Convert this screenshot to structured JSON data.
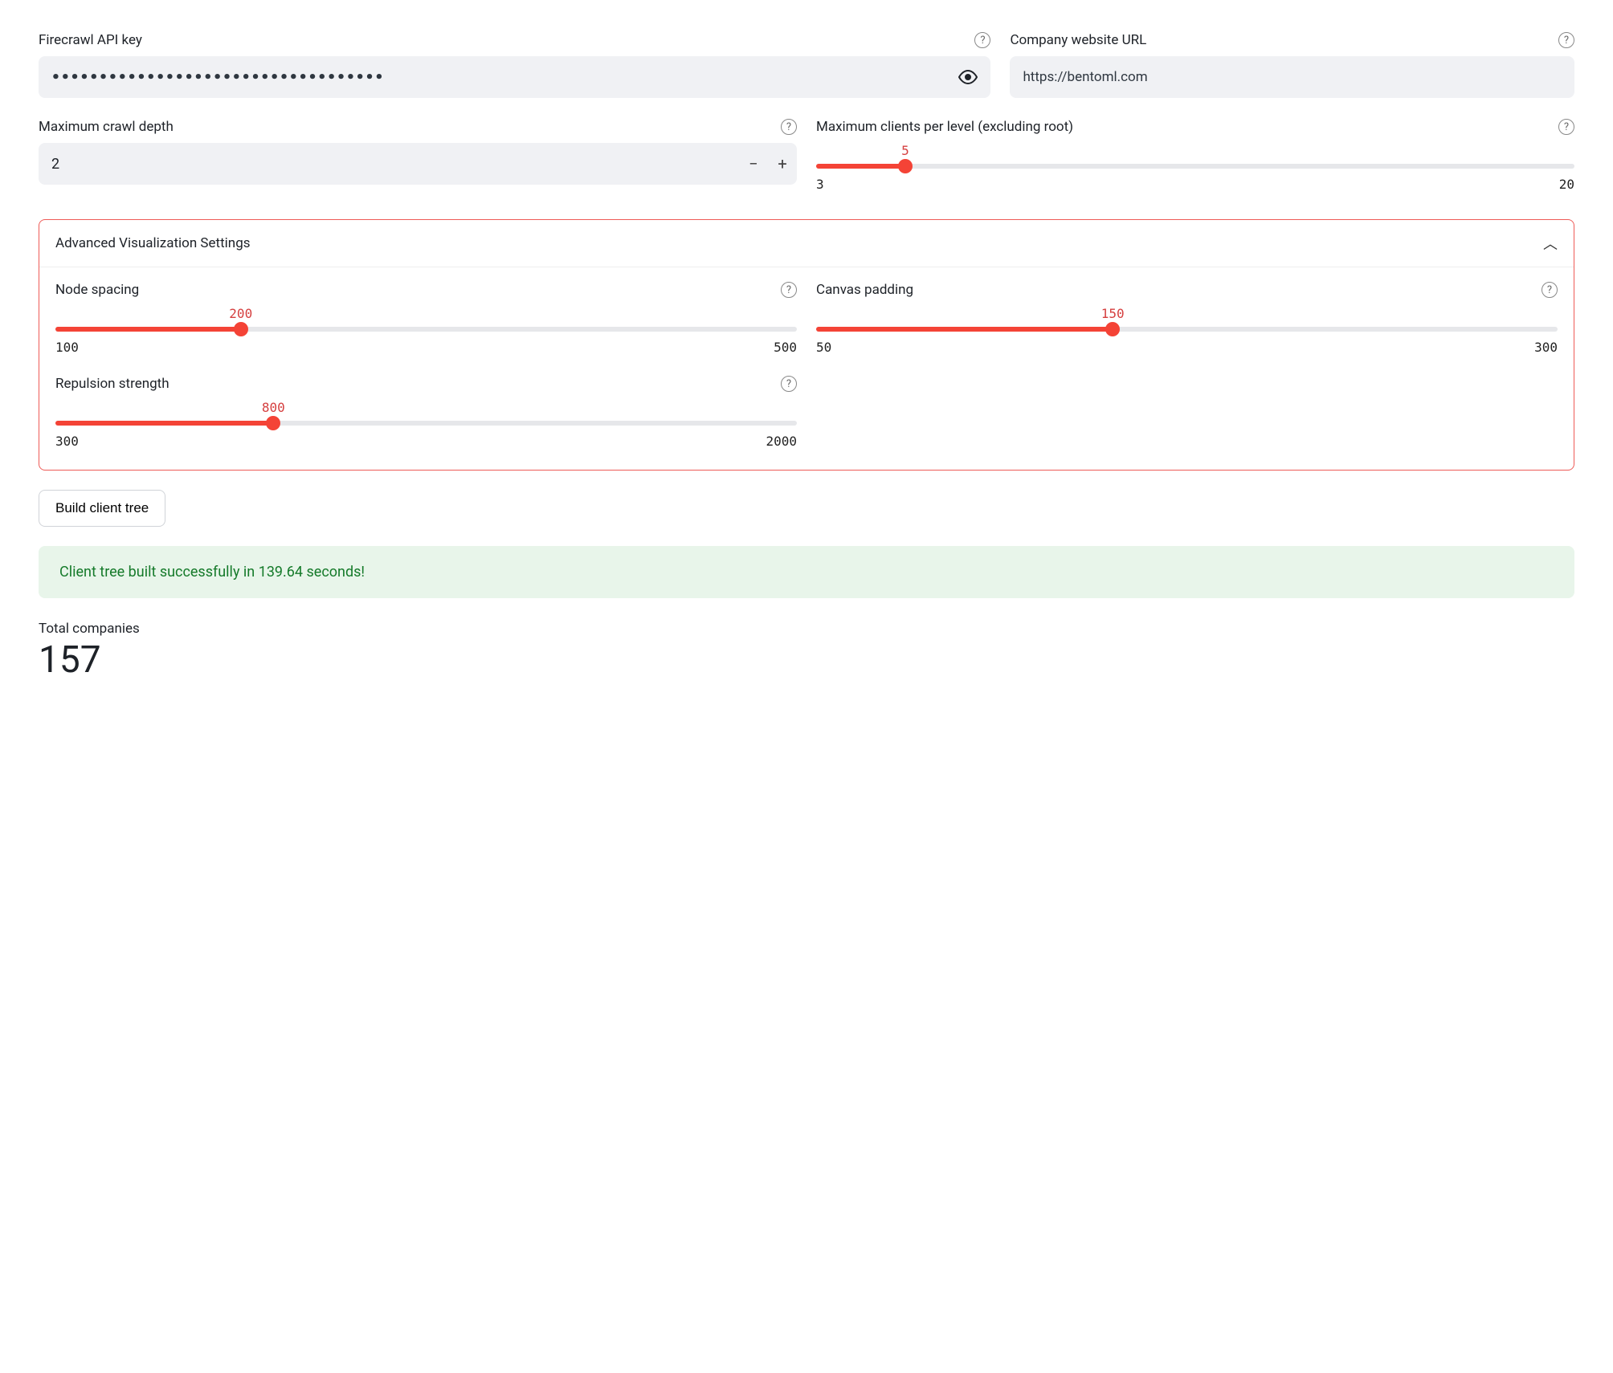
{
  "api_key": {
    "label": "Firecrawl API key",
    "masked_value": "•••••••••••••••••••••••••••••••••••"
  },
  "url": {
    "label": "Company website URL",
    "value": "https://bentoml.com"
  },
  "depth": {
    "label": "Maximum crawl depth",
    "value": "2"
  },
  "max_clients": {
    "label": "Maximum clients per level (excluding root)",
    "value": "5",
    "min": "3",
    "max": "20"
  },
  "expander": {
    "title": "Advanced Visualization Settings"
  },
  "node_spacing": {
    "label": "Node spacing",
    "value": "200",
    "min": "100",
    "max": "500"
  },
  "canvas_padding": {
    "label": "Canvas padding",
    "value": "150",
    "min": "50",
    "max": "300"
  },
  "repulsion": {
    "label": "Repulsion strength",
    "value": "800",
    "min": "300",
    "max": "2000"
  },
  "build_btn": "Build client tree",
  "success_msg": "Client tree built successfully in 139.64 seconds!",
  "metric": {
    "label": "Total companies",
    "value": "157"
  }
}
